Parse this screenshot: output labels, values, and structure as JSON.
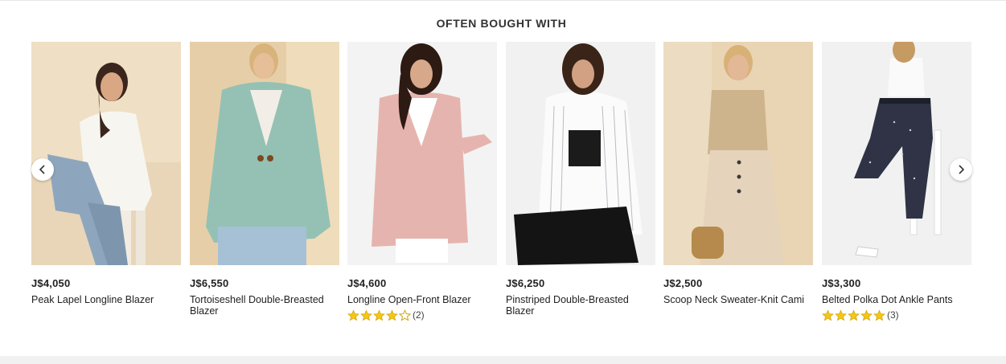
{
  "section": {
    "title": "OFTEN BOUGHT WITH"
  },
  "icons": {
    "prev": "chevron-left-icon",
    "next": "chevron-right-icon",
    "star": "star-icon"
  },
  "colors": {
    "star_fill": "#f5c518",
    "star_empty": "#ffffff",
    "text": "#222222"
  },
  "products": [
    {
      "price": "J$4,050",
      "name": "Peak Lapel Longline Blazer",
      "rating": null,
      "rating_count": ""
    },
    {
      "price": "J$6,550",
      "name": "Tortoiseshell Double-Breasted Blazer",
      "rating": null,
      "rating_count": ""
    },
    {
      "price": "J$4,600",
      "name": "Longline Open-Front Blazer",
      "rating": 4,
      "rating_count": "(2)"
    },
    {
      "price": "J$6,250",
      "name": "Pinstriped Double-Breasted Blazer",
      "rating": null,
      "rating_count": ""
    },
    {
      "price": "J$2,500",
      "name": "Scoop Neck Sweater-Knit Cami",
      "rating": null,
      "rating_count": ""
    },
    {
      "price": "J$3,300",
      "name": "Belted Polka Dot Ankle Pants",
      "rating": 5,
      "rating_count": "(3)"
    }
  ]
}
